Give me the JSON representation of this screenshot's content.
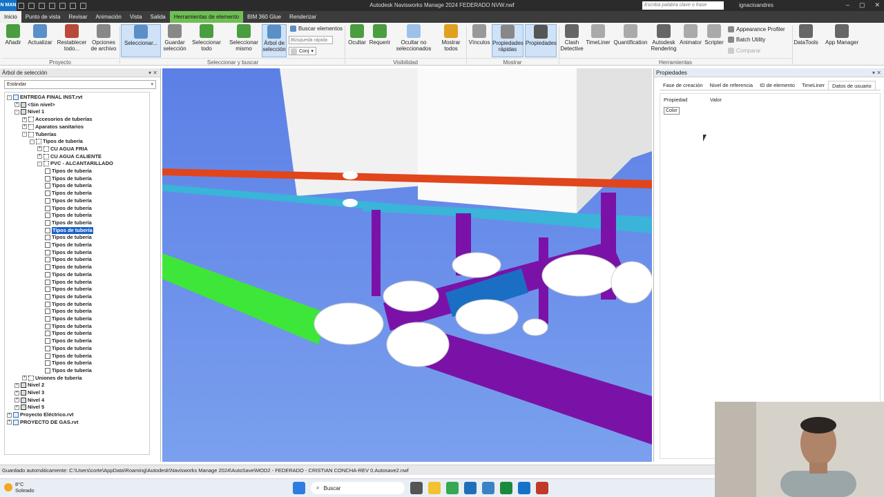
{
  "app": {
    "logo_text": "N MAN",
    "title": "Autodesk Navisworks Manage 2024   FEDERADO NVW.nwf",
    "search_placeholder": "Escriba palabra clave o frase",
    "user": "ignacioandres"
  },
  "tabs": [
    "Inicio",
    "Punto de vista",
    "Revisar",
    "Animación",
    "Vista",
    "Salida",
    "Herramientas de elemento",
    "BIM 360 Glue",
    "Renderizar"
  ],
  "ribbon": {
    "buttons": [
      {
        "label": "Añadir",
        "icon": "add-icon",
        "color": "#4a9e3f"
      },
      {
        "label": "Actualizar",
        "icon": "refresh-icon",
        "color": "#5a8fc8"
      },
      {
        "label": "Restablecer todo...",
        "icon": "reset-icon",
        "color": "#b84a3a"
      },
      {
        "label": "Opciones de archivo",
        "icon": "file-options-icon",
        "color": "#777"
      },
      {
        "label": "Seleccionar...",
        "icon": "cursor-icon",
        "color": "#5a8fc8"
      },
      {
        "label": "Guardar selección",
        "icon": "save-selection-icon",
        "color": "#777"
      },
      {
        "label": "Seleccionar todo",
        "icon": "select-all-icon",
        "color": "#4a9e3f"
      },
      {
        "label": "Seleccionar mismo",
        "icon": "select-same-icon",
        "color": "#4a9e3f"
      },
      {
        "label": "Árbol de selección",
        "icon": "selection-tree-icon",
        "color": "#5a8fc8"
      },
      {
        "label": "Ocultar",
        "icon": "hide-icon",
        "color": "#4a9e3f"
      },
      {
        "label": "Requerir",
        "icon": "require-icon",
        "color": "#4a9e3f"
      },
      {
        "label": "Ocultar no seleccionados",
        "icon": "hide-unselected-icon",
        "color": "#5a8fc8"
      },
      {
        "label": "Mostrar todos",
        "icon": "show-all-icon",
        "color": "#e0a020"
      },
      {
        "label": "Vínculos",
        "icon": "links-icon",
        "color": "#777"
      },
      {
        "label": "Propiedades rápidas",
        "icon": "quick-properties-icon",
        "color": "#777"
      },
      {
        "label": "Propiedades",
        "icon": "properties-icon",
        "color": "#555"
      },
      {
        "label": "Clash Detective",
        "icon": "clash-detective-icon",
        "color": "#555"
      },
      {
        "label": "TimeLiner",
        "icon": "timeliner-icon",
        "color": "#777"
      },
      {
        "label": "Quantification",
        "icon": "quantification-icon",
        "color": "#777"
      },
      {
        "label": "Autodesk Rendering",
        "icon": "rendering-icon",
        "color": "#555"
      },
      {
        "label": "Animator",
        "icon": "animator-icon",
        "color": "#777"
      },
      {
        "label": "Scripter",
        "icon": "scripter-icon",
        "color": "#777"
      },
      {
        "label": "DataTools",
        "icon": "datatools-icon",
        "color": "#555"
      },
      {
        "label": "App Manager",
        "icon": "app-manager-icon",
        "color": "#555"
      }
    ],
    "small": {
      "buscar": "Buscar elementos",
      "busqueda_placeholder": "Búsqueda rápida",
      "conj": "Conj",
      "appearance_profiler": "Appearance Profiler",
      "batch_utility": "Batch Utility",
      "comparar": "Comparar"
    },
    "groups": [
      "Proyecto",
      "Seleccionar y buscar",
      "Visibilidad",
      "Mostrar",
      "Herramientas"
    ]
  },
  "left_panel": {
    "title": "Árbol de selección",
    "dropdown": "Estándar",
    "tree": [
      {
        "label": "ENTREGA FINAL INST.rvt",
        "indent": 0,
        "exp": "-",
        "icon": "file"
      },
      {
        "label": "<Sin nivel>",
        "indent": 1,
        "exp": "+",
        "icon": "layer"
      },
      {
        "label": "Nivel 1",
        "indent": 1,
        "exp": "-",
        "icon": "layer"
      },
      {
        "label": "Accesorios de tuberías",
        "indent": 2,
        "exp": "+",
        "icon": "group"
      },
      {
        "label": "Aparatos sanitarios",
        "indent": 2,
        "exp": "+",
        "icon": "group"
      },
      {
        "label": "Tuberías",
        "indent": 2,
        "exp": "-",
        "icon": "group"
      },
      {
        "label": "Tipos de tubería",
        "indent": 3,
        "exp": "-",
        "icon": "group"
      },
      {
        "label": "CU AGUA FRIA",
        "indent": 4,
        "exp": "+",
        "icon": "group"
      },
      {
        "label": "CU AGUA CALIENTE",
        "indent": 4,
        "exp": "+",
        "icon": "group"
      },
      {
        "label": "PVC - ALCANTARILLADO",
        "indent": 4,
        "exp": "-",
        "icon": "group"
      },
      {
        "label": "Tipos de tubería",
        "indent": 5,
        "icon": "geo"
      },
      {
        "label": "Tipos de tubería",
        "indent": 5,
        "icon": "geo"
      },
      {
        "label": "Tipos de tubería",
        "indent": 5,
        "icon": "geo"
      },
      {
        "label": "Tipos de tubería",
        "indent": 5,
        "icon": "geo"
      },
      {
        "label": "Tipos de tubería",
        "indent": 5,
        "icon": "geo"
      },
      {
        "label": "Tipos de tubería",
        "indent": 5,
        "icon": "geo"
      },
      {
        "label": "Tipos de tubería",
        "indent": 5,
        "icon": "geo"
      },
      {
        "label": "Tipos de tubería",
        "indent": 5,
        "icon": "geo"
      },
      {
        "label": "Tipos de tubería",
        "indent": 5,
        "icon": "geo",
        "selected": true
      },
      {
        "label": "Tipos de tubería",
        "indent": 5,
        "icon": "geo"
      },
      {
        "label": "Tipos de tubería",
        "indent": 5,
        "icon": "geo"
      },
      {
        "label": "Tipos de tubería",
        "indent": 5,
        "icon": "geo"
      },
      {
        "label": "Tipos de tubería",
        "indent": 5,
        "icon": "geo"
      },
      {
        "label": "Tipos de tubería",
        "indent": 5,
        "icon": "geo"
      },
      {
        "label": "Tipos de tubería",
        "indent": 5,
        "icon": "geo"
      },
      {
        "label": "Tipos de tubería",
        "indent": 5,
        "icon": "geo"
      },
      {
        "label": "Tipos de tubería",
        "indent": 5,
        "icon": "geo"
      },
      {
        "label": "Tipos de tubería",
        "indent": 5,
        "icon": "geo"
      },
      {
        "label": "Tipos de tubería",
        "indent": 5,
        "icon": "geo"
      },
      {
        "label": "Tipos de tubería",
        "indent": 5,
        "icon": "geo"
      },
      {
        "label": "Tipos de tubería",
        "indent": 5,
        "icon": "geo"
      },
      {
        "label": "Tipos de tubería",
        "indent": 5,
        "icon": "geo"
      },
      {
        "label": "Tipos de tubería",
        "indent": 5,
        "icon": "geo"
      },
      {
        "label": "Tipos de tubería",
        "indent": 5,
        "icon": "geo"
      },
      {
        "label": "Tipos de tubería",
        "indent": 5,
        "icon": "geo"
      },
      {
        "label": "Tipos de tubería",
        "indent": 5,
        "icon": "geo"
      },
      {
        "label": "Tipos de tubería",
        "indent": 5,
        "icon": "geo"
      },
      {
        "label": "Tipos de tubería",
        "indent": 5,
        "icon": "geo"
      },
      {
        "label": "Uniones de tubería",
        "indent": 2,
        "exp": "+",
        "icon": "group"
      },
      {
        "label": "Nivel 2",
        "indent": 1,
        "exp": "+",
        "icon": "layer"
      },
      {
        "label": "Nivel 3",
        "indent": 1,
        "exp": "+",
        "icon": "layer"
      },
      {
        "label": "Nivel 4",
        "indent": 1,
        "exp": "+",
        "icon": "layer"
      },
      {
        "label": "Nivel 5",
        "indent": 1,
        "exp": "+",
        "icon": "layer"
      },
      {
        "label": "Proyecto Eléctrico.rvt",
        "indent": 0,
        "exp": "+",
        "icon": "file"
      },
      {
        "label": "PROYECTO DE GAS.rvt",
        "indent": 0,
        "exp": "+",
        "icon": "file"
      }
    ]
  },
  "right_panel": {
    "title": "Propiedades",
    "tabs": [
      "Fase de creación",
      "Nivel de referencia",
      "ID de elemento",
      "TimeLiner",
      "Datos de usuario"
    ],
    "col_property": "Propiedad",
    "col_value": "Valor",
    "cell": "Color"
  },
  "status": "Guardado automáticamente: C:\\Users\\corte\\AppData\\Roaming\\Autodesk\\Navisworks Manage 2024\\AutoSave\\MOD2 - FEDERADO - CRISTIAN CONCHA-REV 0.Autosave2.nwf",
  "taskbar": {
    "temp": "8°C",
    "weather": "Soleado",
    "search": "Buscar"
  },
  "colors": {
    "sky_top": "#5c7fe6",
    "sky_bottom": "#7aa0ee",
    "green_pipe": "#3ee63a",
    "red_pipe": "#e0451c",
    "cyan_pipe": "#3ab4d8",
    "purple_pipe": "#7b12a8",
    "blue_pipe": "#1a6fc4"
  }
}
